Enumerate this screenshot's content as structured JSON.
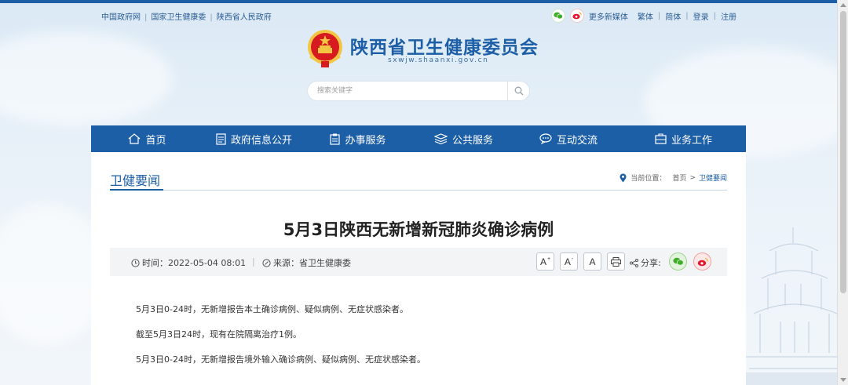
{
  "top_links": [
    "中国政府网",
    "国家卫生健康委",
    "陕西省人民政府"
  ],
  "top_right": {
    "media_label": "更多新媒体",
    "links": [
      "繁体",
      "简体",
      "登录",
      "注册"
    ]
  },
  "site": {
    "title": "陕西省卫生健康委员会",
    "domain": "sxwjw.shaanxi.gov.cn"
  },
  "search": {
    "placeholder": "搜索关键字"
  },
  "nav": [
    {
      "label": "首页",
      "icon": "home-icon"
    },
    {
      "label": "政府信息公开",
      "icon": "document-icon"
    },
    {
      "label": "办事服务",
      "icon": "clipboard-icon"
    },
    {
      "label": "公共服务",
      "icon": "layers-icon"
    },
    {
      "label": "互动交流",
      "icon": "chat-icon"
    },
    {
      "label": "业务工作",
      "icon": "briefcase-icon"
    }
  ],
  "section": {
    "title": "卫健要闻",
    "breadcrumb": {
      "prefix": "当前位置：",
      "home": "首页",
      "sep": ">",
      "current": "卫健要闻"
    }
  },
  "article": {
    "title": "5月3日陕西无新增新冠肺炎确诊病例",
    "time_label": "时间：",
    "time": "2022-05-04 08:01",
    "source_label": "来源：",
    "source": "省卫生健康委",
    "font_buttons": [
      "A",
      "A",
      "A"
    ],
    "share_label": "分享:",
    "paragraphs": [
      "5月3日0-24时，无新增报告本土确诊病例、疑似病例、无症状感染者。",
      "截至5月3日24时，现有在院隔离治疗1例。",
      "5月3日0-24时，无新增报告境外输入确诊病例、疑似病例、无症状感染者。"
    ]
  },
  "colors": {
    "brand": "#1d5fa6",
    "wechat": "#3fae29",
    "weibo": "#e6162d"
  }
}
